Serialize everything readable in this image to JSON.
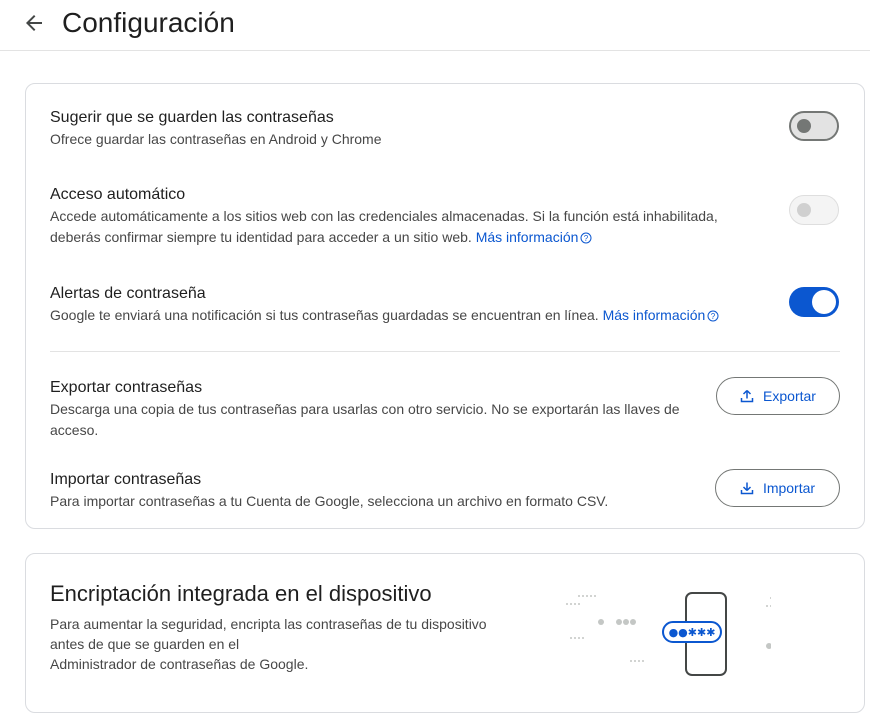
{
  "header": {
    "title": "Configuración",
    "back_icon": "arrow-left-icon"
  },
  "settings": {
    "suggest_save": {
      "title": "Sugerir que se guarden las contraseñas",
      "desc": "Ofrece guardar las contraseñas en Android y Chrome",
      "toggle_state": "off"
    },
    "auto_signin": {
      "title": "Acceso automático",
      "desc_line1": "Accede automáticamente a los sitios web con las credenciales almacenadas. Si la función está inhabilitada,",
      "desc_line2": "deberás confirmar siempre tu identidad para acceder a un sitio web.",
      "link": "Más información",
      "toggle_state": "disabled"
    },
    "password_alerts": {
      "title": "Alertas de contraseña",
      "desc": "Google te enviará una notificación si tus contraseñas guardadas se encuentran en línea.",
      "link": "Más información",
      "toggle_state": "on"
    },
    "export": {
      "title": "Exportar contraseñas",
      "desc_line1": "Descarga una copia de tus contraseñas para usarlas con otro servicio. No se exportarán las llaves de",
      "desc_line2": "acceso.",
      "button": "Exportar",
      "icon": "upload-icon"
    },
    "import": {
      "title": "Importar contraseñas",
      "desc": "Para importar contraseñas a tu Cuenta de Google, selecciona un archivo en formato CSV.",
      "button": "Importar",
      "icon": "download-icon"
    }
  },
  "encryption": {
    "title": "Encriptación integrada en el dispositivo",
    "desc_line1": "Para aumentar la seguridad, encripta las contraseñas de tu dispositivo",
    "desc_line2": "antes de que se guarden en el",
    "desc_line3": "Administrador de contraseñas de Google.",
    "illustration_password": "●●✱✱✱"
  },
  "colors": {
    "accent": "#0b57d0",
    "text_primary": "#1f1f1f",
    "text_secondary": "#474747",
    "border": "#dadce0"
  }
}
